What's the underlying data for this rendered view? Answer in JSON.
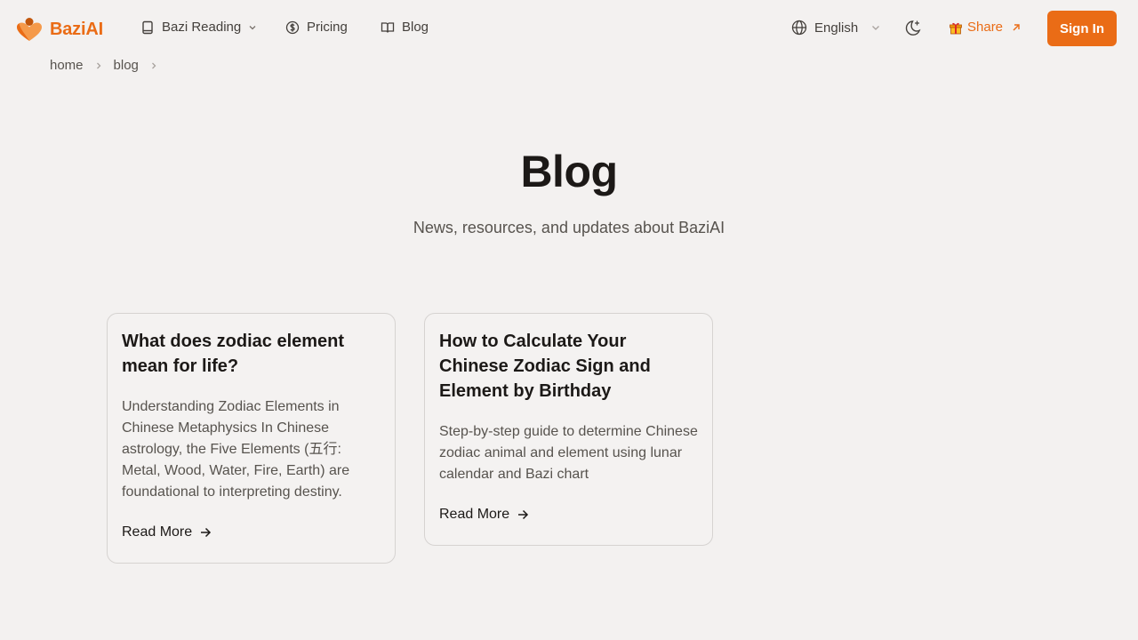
{
  "brand": {
    "name": "BaziAI",
    "color": "#ea6c16"
  },
  "nav": {
    "items": [
      {
        "label": "Bazi Reading",
        "icon": "book-icon",
        "has_dropdown": true
      },
      {
        "label": "Pricing",
        "icon": "dollar-circle-icon"
      },
      {
        "label": "Blog",
        "icon": "open-book-icon"
      }
    ],
    "language": "English",
    "share_label": "Share",
    "signin_label": "Sign In"
  },
  "breadcrumb": [
    "home",
    "blog"
  ],
  "hero": {
    "title": "Blog",
    "subtitle": "News, resources, and updates about BaziAI"
  },
  "posts": [
    {
      "title": "What does zodiac element mean for life?",
      "description": "Understanding Zodiac Elements in Chinese Metaphysics In Chinese astrology, the Five Elements (五行: Metal, Wood, Water, Fire, Earth) are foundational to interpreting destiny.",
      "link_label": "Read More"
    },
    {
      "title": "How to Calculate Your Chinese Zodiac Sign and Element by Birthday",
      "description": "Step-by-step guide to determine Chinese zodiac animal and element using lunar calendar and Bazi chart",
      "link_label": "Read More"
    }
  ]
}
